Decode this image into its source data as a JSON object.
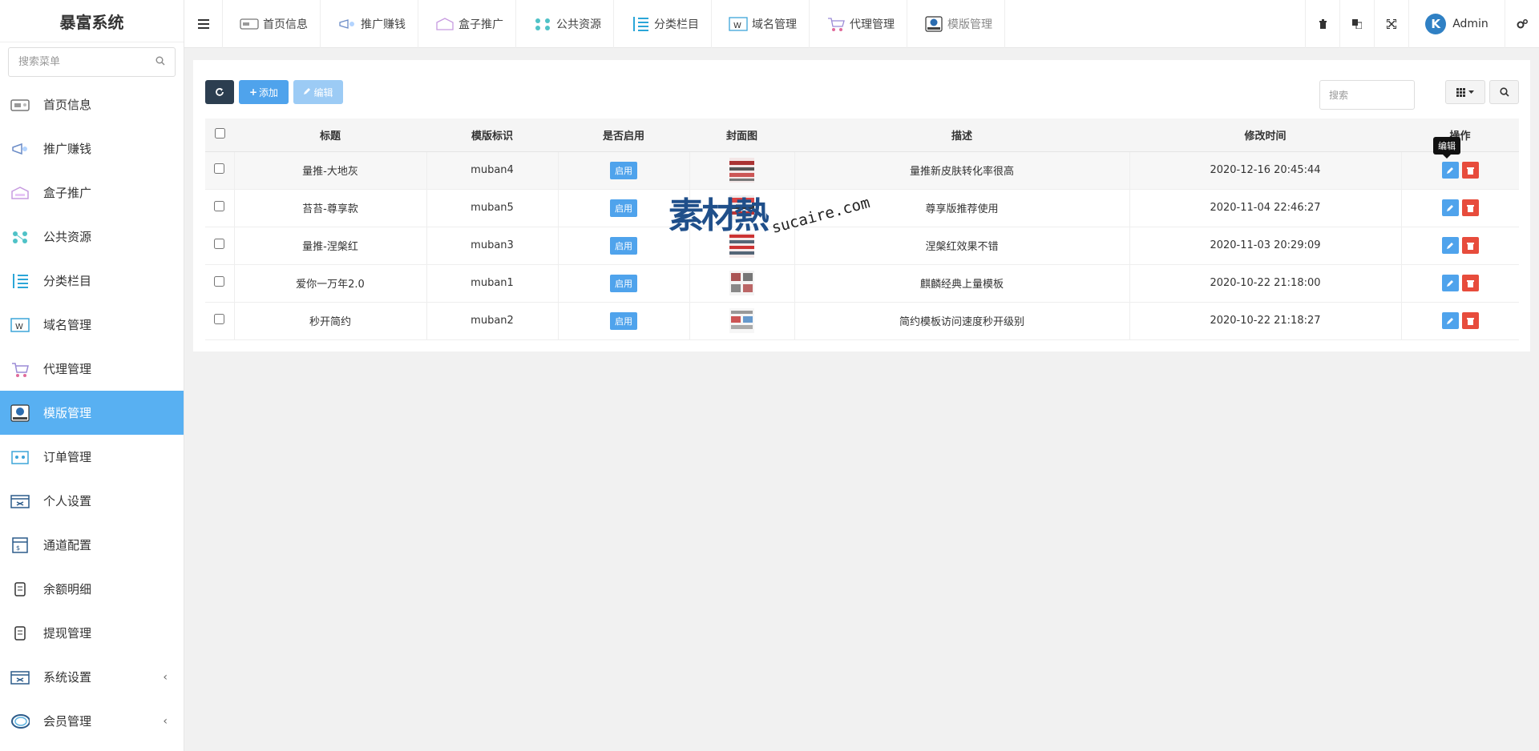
{
  "app": {
    "title": "暴富系统"
  },
  "sidebar": {
    "search_placeholder": "搜索菜单",
    "items": [
      {
        "label": "首页信息",
        "icon": "home-info-icon",
        "has_arrow": false
      },
      {
        "label": "推广赚钱",
        "icon": "promote-icon",
        "has_arrow": false
      },
      {
        "label": "盒子推广",
        "icon": "box-icon",
        "has_arrow": false
      },
      {
        "label": "公共资源",
        "icon": "resource-icon",
        "has_arrow": false
      },
      {
        "label": "分类栏目",
        "icon": "category-icon",
        "has_arrow": false
      },
      {
        "label": "域名管理",
        "icon": "domain-icon",
        "has_arrow": false
      },
      {
        "label": "代理管理",
        "icon": "agent-icon",
        "has_arrow": false
      },
      {
        "label": "模版管理",
        "icon": "template-icon",
        "has_arrow": false,
        "active": true
      },
      {
        "label": "订单管理",
        "icon": "order-icon",
        "has_arrow": false
      },
      {
        "label": "个人设置",
        "icon": "profile-icon",
        "has_arrow": false
      },
      {
        "label": "通道配置",
        "icon": "channel-icon",
        "has_arrow": false
      },
      {
        "label": "余额明细",
        "icon": "balance-icon",
        "has_arrow": false
      },
      {
        "label": "提现管理",
        "icon": "withdraw-icon",
        "has_arrow": false
      },
      {
        "label": "系统设置",
        "icon": "system-icon",
        "has_arrow": true,
        "arrow": "‹"
      },
      {
        "label": "会员管理",
        "icon": "member-icon",
        "has_arrow": true,
        "arrow": "‹"
      }
    ]
  },
  "topnav": {
    "items": [
      {
        "label": "首页信息"
      },
      {
        "label": "推广赚钱"
      },
      {
        "label": "盒子推广"
      },
      {
        "label": "公共资源"
      },
      {
        "label": "分类栏目"
      },
      {
        "label": "域名管理"
      },
      {
        "label": "代理管理"
      },
      {
        "label": "模版管理",
        "active": true
      }
    ],
    "user": "Admin",
    "avatar_letter": "K"
  },
  "toolbar": {
    "add_label": "添加",
    "edit_label": "编辑",
    "search_placeholder": "搜索"
  },
  "table": {
    "headers": [
      "标题",
      "模版标识",
      "是否启用",
      "封面图",
      "描述",
      "修改时间",
      "操作"
    ],
    "rows": [
      {
        "title": "量推-大地灰",
        "code": "muban4",
        "status": "启用",
        "desc": "量推新皮肤转化率很高",
        "time": "2020-12-16 20:45:44"
      },
      {
        "title": "苔苔-尊享款",
        "code": "muban5",
        "status": "启用",
        "desc": "尊享版推荐使用",
        "time": "2020-11-04 22:46:27"
      },
      {
        "title": "量推-涅槃红",
        "code": "muban3",
        "status": "启用",
        "desc": "涅槃红效果不错",
        "time": "2020-11-03 20:29:09"
      },
      {
        "title": "爱你一万年2.0",
        "code": "muban1",
        "status": "启用",
        "desc": "麒麟经典上量模板",
        "time": "2020-10-22 21:18:00"
      },
      {
        "title": "秒开简约",
        "code": "muban2",
        "status": "启用",
        "desc": "简约模板访问速度秒开级别",
        "time": "2020-10-22 21:18:27"
      }
    ],
    "tooltip": "编辑"
  },
  "watermark": {
    "cn": "素材熱",
    "en": "sucaire.com"
  },
  "colors": {
    "accent": "#58b0f2",
    "primary": "#4fa3ec",
    "danger": "#e74c3c",
    "dark": "#2c3e50"
  }
}
